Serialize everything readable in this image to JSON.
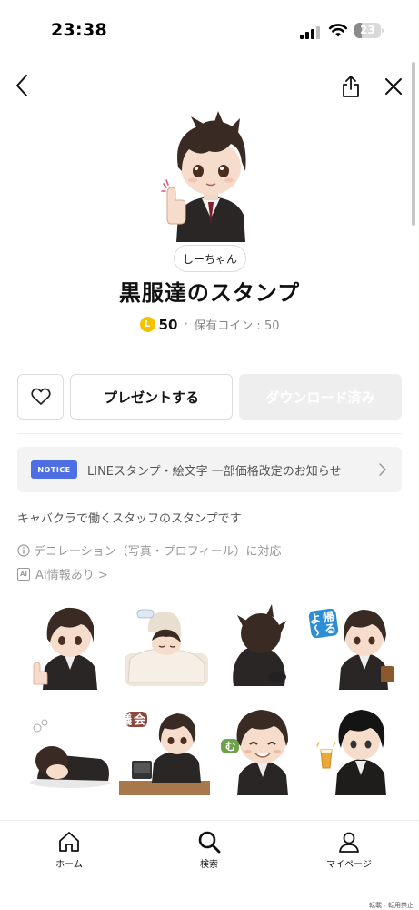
{
  "status_bar": {
    "time": "23:38",
    "battery": "23"
  },
  "sticker_pack": {
    "author": "しーちゃん",
    "title": "黒服達のスタンプ",
    "price": "50",
    "coin_symbol": "L",
    "owned_coins": "保有コイン : 50",
    "description": "キャバクラで働くスタッフのスタンプです",
    "decoration_note": "デコレーション（写真・プロフィール）に対応",
    "ai_badge": "AI",
    "ai_note": "AI情報あり >"
  },
  "actions": {
    "gift_label": "プレゼントする",
    "download_label": "ダウンロード済み"
  },
  "notice": {
    "badge": "NOTICE",
    "text": "LINEスタンプ・絵文字 一部価格改定のお知らせ"
  },
  "stickers": [
    {
      "name": "thumbs-up",
      "caption": ""
    },
    {
      "name": "sleeping-in-bed",
      "caption": ""
    },
    {
      "name": "sitting-back-view",
      "caption": ""
    },
    {
      "name": "going-home",
      "caption": "帰るよ〜"
    },
    {
      "name": "collapsed",
      "caption": ""
    },
    {
      "name": "in-meeting",
      "caption": "会議中"
    },
    {
      "name": "cant-do-it",
      "caption": "むりっ"
    },
    {
      "name": "toasting-drink",
      "caption": ""
    }
  ],
  "bottom_nav": [
    {
      "label": "ホーム",
      "icon": "home-icon"
    },
    {
      "label": "検索",
      "icon": "search-icon"
    },
    {
      "label": "マイページ",
      "icon": "person-icon"
    }
  ],
  "watermark": "転載・転用禁止",
  "colors": {
    "notice_badge": "#4d6fe3",
    "coin": "#f4c300",
    "download_disabled": "#eeeeee"
  }
}
